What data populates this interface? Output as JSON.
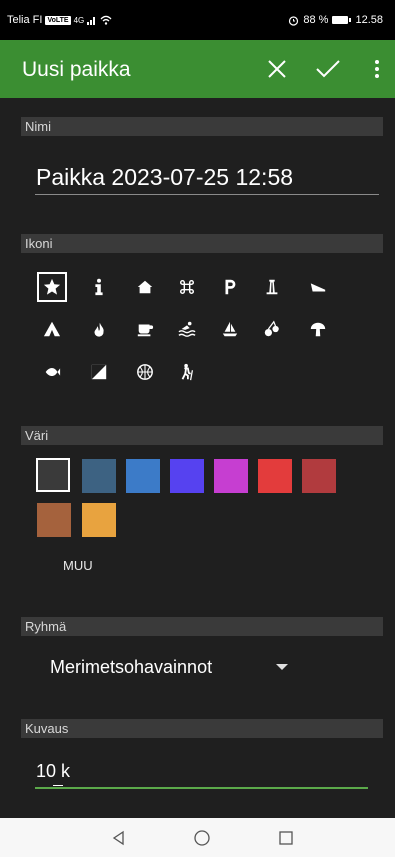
{
  "status_bar": {
    "carrier": "Telia FI",
    "net_badge": "VoLTE",
    "signal": "4G",
    "battery": "88 %",
    "time": "12.58"
  },
  "toolbar": {
    "title": "Uusi paikka",
    "close_icon": "close-icon",
    "confirm_icon": "check-icon",
    "menu_icon": "more-vert-icon"
  },
  "name_section": {
    "header": "Nimi",
    "value": "Paikka 2023-07-25 12:58"
  },
  "icon_section": {
    "header": "Ikoni",
    "icons": [
      "star-icon",
      "info-icon",
      "home-icon",
      "command-icon",
      "parking-icon",
      "lighthouse-icon",
      "sauna-icon",
      "tent-icon",
      "fire-icon",
      "cafe-icon",
      "swimming-icon",
      "sailboat-icon",
      "cherry-icon",
      "mushroom-icon",
      "fish-icon",
      "contrast-icon",
      "basketball-icon",
      "hiking-icon"
    ],
    "selected_index": 0
  },
  "color_section": {
    "header": "Väri",
    "colors": [
      "#3a3a3a",
      "#3d6282",
      "#3c7bc8",
      "#5642f0",
      "#c63ed1",
      "#e33c3c",
      "#b13b3e",
      "#a5623d",
      "#e8a33f"
    ],
    "selected_index": 0,
    "more_label": "MUU"
  },
  "group_section": {
    "header": "Ryhmä",
    "selected": "Merimetsohavainnot"
  },
  "description_section": {
    "header": "Kuvaus",
    "value": "10 k"
  },
  "nav_bar": {
    "back_icon": "back-icon",
    "home_icon": "home-circle-icon",
    "recents_icon": "recents-icon"
  }
}
